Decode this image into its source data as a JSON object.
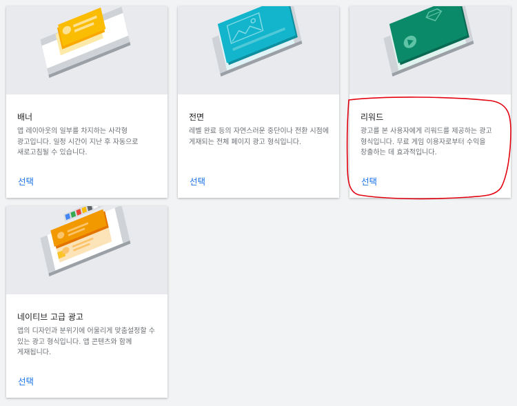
{
  "cards": [
    {
      "id": "banner",
      "title": "배너",
      "description": "앱 레이아웃의 일부를 차지하는 사각형 광고입니다. 일정 시간이 지난 후 자동으로 새로고침될 수 있습니다.",
      "action": "선택",
      "accent": "#fbbc04"
    },
    {
      "id": "interstitial",
      "title": "전면",
      "description": "레벨 완료 등의 자연스러운 중단이나 전환 시점에 게재되는 전체 페이지 광고 형식입니다.",
      "action": "선택",
      "accent": "#12b5cb"
    },
    {
      "id": "rewarded",
      "title": "리워드",
      "description": "광고를 본 사용자에게 리워드를 제공하는 광고 형식입니다. 무료 게임 이용자로부터 수익을 창출하는 데 효과적입니다.",
      "action": "선택",
      "accent": "#0b8a6a"
    },
    {
      "id": "native",
      "title": "네이티브 고급 광고",
      "description": "앱의 디자인과 분위기에 어울리게 맞춤설정할 수 있는 광고 형식입니다. 앱 콘텐츠와 함께 게재됩니다.",
      "action": "선택",
      "accent": "#f29900"
    }
  ],
  "colors": {
    "page_background": "#f1f3f4",
    "card_background": "#ffffff",
    "illustration_background": "#e8eaed",
    "link": "#1a73e8",
    "annotation": "#e3000f"
  }
}
